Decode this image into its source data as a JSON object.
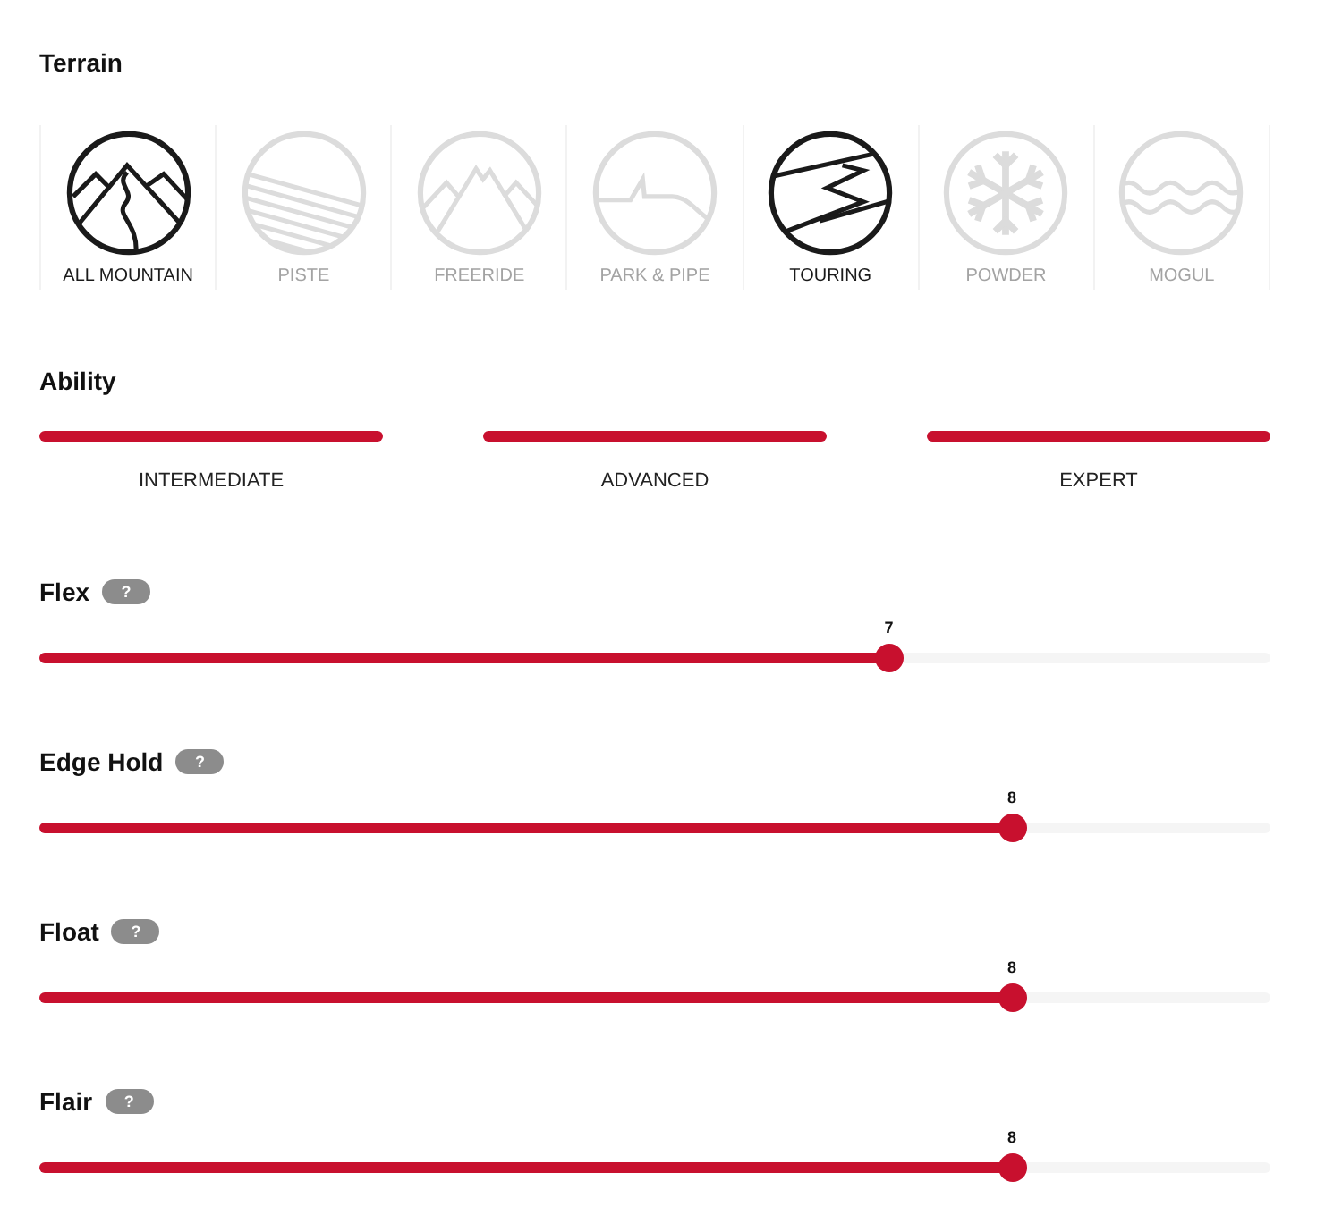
{
  "terrain": {
    "title": "Terrain",
    "options": [
      {
        "label": "ALL MOUNTAIN",
        "selected": true
      },
      {
        "label": "PISTE",
        "selected": false
      },
      {
        "label": "FREERIDE",
        "selected": false
      },
      {
        "label": "PARK & PIPE",
        "selected": false
      },
      {
        "label": "TOURING",
        "selected": true
      },
      {
        "label": "POWDER",
        "selected": false
      },
      {
        "label": "MOGUL",
        "selected": false
      }
    ]
  },
  "ability": {
    "title": "Ability",
    "levels": [
      {
        "label": "INTERMEDIATE",
        "selected": true
      },
      {
        "label": "ADVANCED",
        "selected": true
      },
      {
        "label": "EXPERT",
        "selected": true
      }
    ]
  },
  "ratings": [
    {
      "label": "Flex",
      "help": "?",
      "value": "7",
      "level": 0.69
    },
    {
      "label": "Edge Hold",
      "help": "?",
      "value": "8",
      "level": 0.79
    },
    {
      "label": "Float",
      "help": "?",
      "value": "8",
      "level": 0.79
    },
    {
      "label": "Flair",
      "help": "?",
      "value": "8",
      "level": 0.79
    }
  ]
}
